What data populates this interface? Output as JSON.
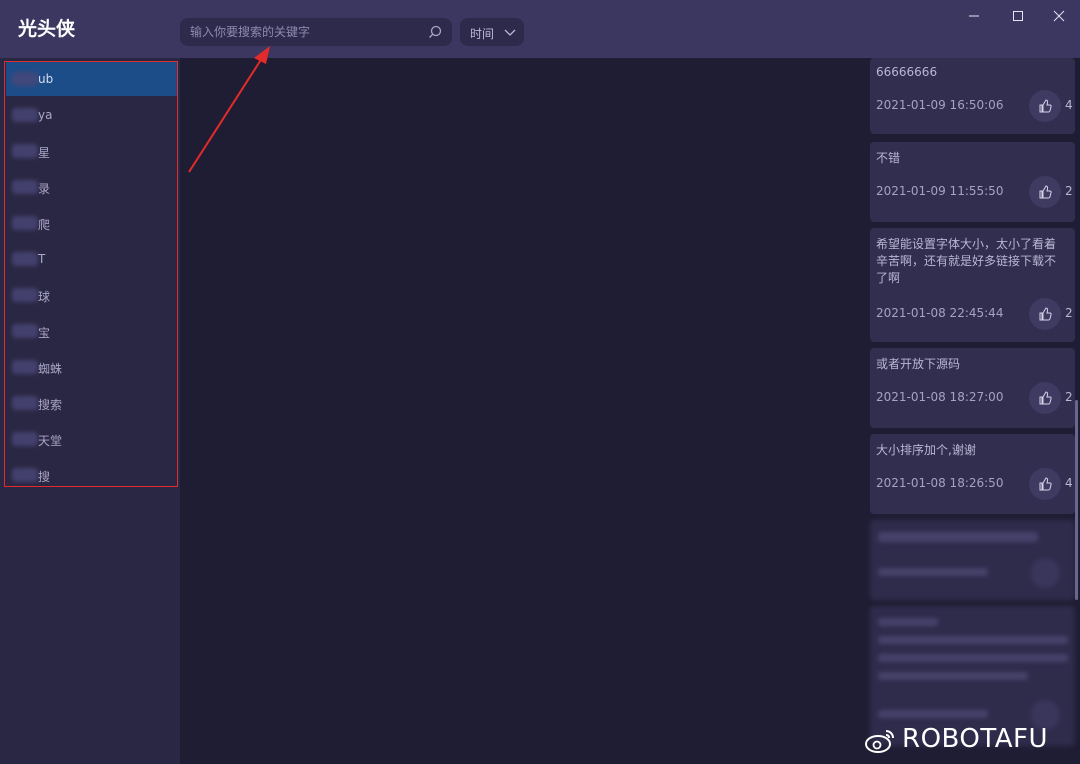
{
  "app": {
    "title": "光头侠"
  },
  "search": {
    "placeholder": "输入你要搜索的关键字",
    "icon": "search-icon"
  },
  "sort": {
    "label": "时间",
    "icon": "chevron-down-icon"
  },
  "window_controls": [
    "minimize-icon",
    "maximize-icon",
    "close-icon"
  ],
  "sidebar": {
    "items": [
      {
        "label": "ub",
        "active": true
      },
      {
        "label": "ya"
      },
      {
        "label": "星"
      },
      {
        "label": "录"
      },
      {
        "label": "爬"
      },
      {
        "label": "T"
      },
      {
        "label": "球"
      },
      {
        "label": "宝"
      },
      {
        "label": "蜘蛛"
      },
      {
        "label": "搜索"
      },
      {
        "label": "天堂"
      },
      {
        "label": "搜"
      }
    ]
  },
  "comments": [
    {
      "text": "66666666",
      "time": "2021-01-09 16:50:06",
      "likes": "4"
    },
    {
      "text": "不错",
      "time": "2021-01-09 11:55:50",
      "likes": "2"
    },
    {
      "text": "希望能设置字体大小，太小了看着辛苦啊，还有就是好多链接下载不了啊",
      "time": "2021-01-08 22:45:44",
      "likes": "2"
    },
    {
      "text": "或者开放下源码",
      "time": "2021-01-08 18:27:00",
      "likes": "2"
    },
    {
      "text": "大小排序加个,谢谢",
      "time": "2021-01-08 18:26:50",
      "likes": "4"
    }
  ],
  "watermark": {
    "text": "ROBOTAFU"
  },
  "colors": {
    "accent_red": "#e32b2b",
    "active_item": "#1d4d88",
    "titlebar": "#3c3761"
  }
}
